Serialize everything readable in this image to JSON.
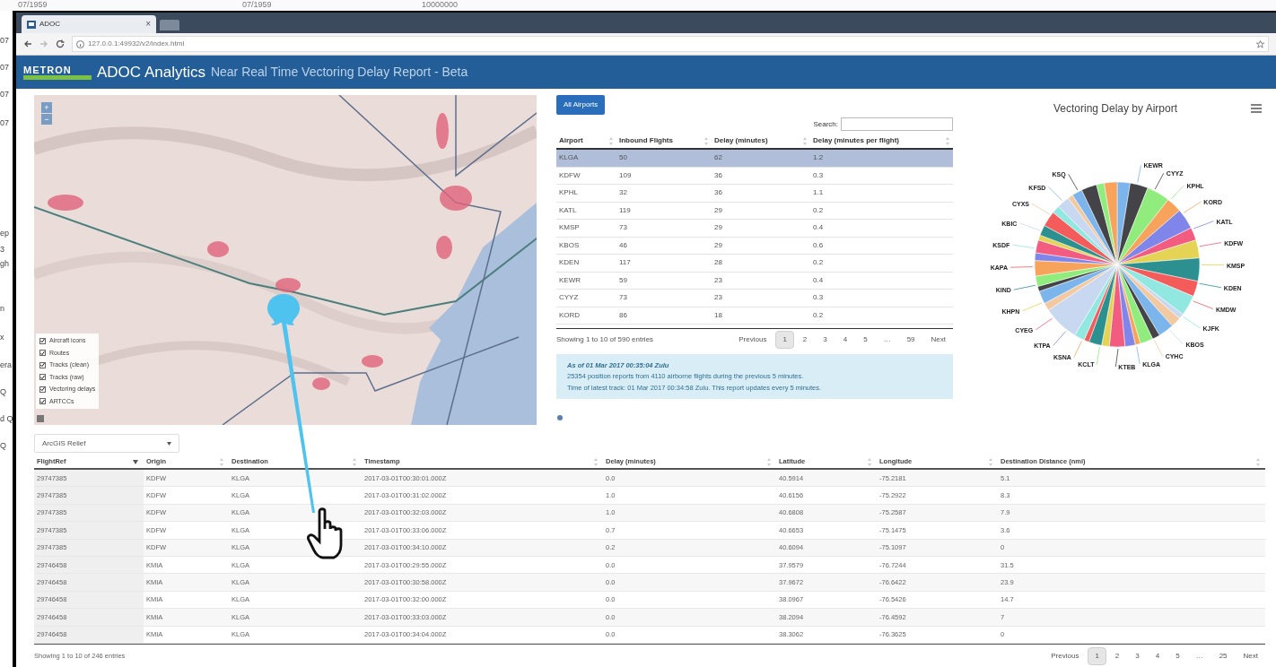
{
  "background_window": {
    "top_fragments": [
      "07/1959",
      "07/1959",
      "10000000"
    ],
    "side_fragments": [
      "07",
      "07",
      "07",
      "07",
      "ep",
      "3",
      "gh",
      "n",
      "x",
      "era",
      "Q",
      "d Q",
      "Q"
    ]
  },
  "browser": {
    "tab_title": "ADOC",
    "tab_close": "×",
    "url": "127.0.0.1:49932/v2/index.html"
  },
  "header": {
    "logo": "METRON",
    "app_name": "ADOC Analytics",
    "subtitle": "Near Real Time Vectoring Delay Report - Beta"
  },
  "map": {
    "zoom_in": "+",
    "zoom_out": "−",
    "layers": [
      {
        "label": "Aircraft icons",
        "checked": true
      },
      {
        "label": "Routes",
        "checked": true
      },
      {
        "label": "Tracks (clean)",
        "checked": true
      },
      {
        "label": "Tracks (raw)",
        "checked": true
      },
      {
        "label": "Vectoring delays",
        "checked": true
      },
      {
        "label": "ARTCCs",
        "checked": true
      }
    ],
    "basemap": "ArcGIS Relief"
  },
  "airports": {
    "button": "All Airports",
    "search_label": "Search:",
    "columns": [
      {
        "label": "Airport",
        "sorted": false
      },
      {
        "label": "Inbound Flights",
        "sorted": false
      },
      {
        "label": "Delay (minutes)",
        "sorted": false
      },
      {
        "label": "Delay (minutes per flight)",
        "sorted": false
      }
    ],
    "rows": [
      {
        "cells": [
          "KLGA",
          "50",
          "62",
          "1.2"
        ],
        "selected": true
      },
      {
        "cells": [
          "KDFW",
          "109",
          "36",
          "0.3"
        ],
        "selected": false
      },
      {
        "cells": [
          "KPHL",
          "32",
          "36",
          "1.1"
        ],
        "selected": false
      },
      {
        "cells": [
          "KATL",
          "119",
          "29",
          "0.2"
        ],
        "selected": false
      },
      {
        "cells": [
          "KMSP",
          "73",
          "29",
          "0.4"
        ],
        "selected": false
      },
      {
        "cells": [
          "KBOS",
          "46",
          "29",
          "0.6"
        ],
        "selected": false
      },
      {
        "cells": [
          "KDEN",
          "117",
          "28",
          "0.2"
        ],
        "selected": false
      },
      {
        "cells": [
          "KEWR",
          "59",
          "23",
          "0.4"
        ],
        "selected": false
      },
      {
        "cells": [
          "CYYZ",
          "73",
          "23",
          "0.3"
        ],
        "selected": false
      },
      {
        "cells": [
          "KORD",
          "86",
          "18",
          "0.2"
        ],
        "selected": false
      }
    ],
    "info": "Showing 1 to 10 of 590 entries",
    "pages": [
      {
        "label": "Previous",
        "selected": false
      },
      {
        "label": "1",
        "selected": true
      },
      {
        "label": "2",
        "selected": false
      },
      {
        "label": "3",
        "selected": false
      },
      {
        "label": "4",
        "selected": false
      },
      {
        "label": "5",
        "selected": false
      },
      {
        "label": "…",
        "selected": false
      },
      {
        "label": "59",
        "selected": false
      },
      {
        "label": "Next",
        "selected": false
      }
    ],
    "notice": [
      "As of 01 Mar 2017 00:35:04 Zulu",
      "25354 position reports from 4110 airborne flights during the previous 5 minutes.",
      "Time of latest track: 01 Mar 2017 00:34:58 Zulu. This report updates every 5 minutes."
    ]
  },
  "pie": {
    "title": "Vectoring Delay by Airport",
    "labels": [
      "KEWR",
      "CYYZ",
      "KPHL",
      "KORD",
      "KATL",
      "KDFW",
      "KMSP",
      "KDEN",
      "KMDW",
      "KJFK",
      "KBOS",
      "CYHC",
      "KLGA",
      "KTEB",
      "KCLT",
      "KSNA",
      "KTPA",
      "CYEG",
      "KHPN",
      "KIND",
      "KAPA",
      "KSDF",
      "KBIC",
      "CYXS",
      "KFSD",
      "KSQ"
    ]
  },
  "flights": {
    "columns": [
      {
        "label": "FlightRef",
        "sorted": true
      },
      {
        "label": "Origin",
        "sorted": false
      },
      {
        "label": "Destination",
        "sorted": false
      },
      {
        "label": "Timestamp",
        "sorted": false
      },
      {
        "label": "Delay (minutes)",
        "sorted": false
      },
      {
        "label": "Latitude",
        "sorted": false
      },
      {
        "label": "Longitude",
        "sorted": false
      },
      {
        "label": "Destination Distance (nmi)",
        "sorted": false
      }
    ],
    "rows": [
      [
        "29747385",
        "KDFW",
        "KLGA",
        "2017-03-01T00:30:01.000Z",
        "0.0",
        "40.5914",
        "-75.2181",
        "5.1"
      ],
      [
        "29747385",
        "KDFW",
        "KLGA",
        "2017-03-01T00:31:02.000Z",
        "1.0",
        "40.6156",
        "-75.2922",
        "8.3"
      ],
      [
        "29747385",
        "KDFW",
        "KLGA",
        "2017-03-01T00:32:03.000Z",
        "1.0",
        "40.6808",
        "-75.2587",
        "7.9"
      ],
      [
        "29747385",
        "KDFW",
        "KLGA",
        "2017-03-01T00:33:06.000Z",
        "0.7",
        "40.6653",
        "-75.1475",
        "3.6"
      ],
      [
        "29747385",
        "KDFW",
        "KLGA",
        "2017-03-01T00:34:10.000Z",
        "0.2",
        "40.6094",
        "-75.1097",
        "0"
      ],
      [
        "29746458",
        "KMIA",
        "KLGA",
        "2017-03-01T00:29:55.000Z",
        "0.0",
        "37.9579",
        "-76.7244",
        "31.5"
      ],
      [
        "29746458",
        "KMIA",
        "KLGA",
        "2017-03-01T00:30:58.000Z",
        "0.0",
        "37.9672",
        "-76.6422",
        "23.9"
      ],
      [
        "29746458",
        "KMIA",
        "KLGA",
        "2017-03-01T00:32:00.000Z",
        "0.0",
        "38.0967",
        "-76.5426",
        "14.7"
      ],
      [
        "29746458",
        "KMIA",
        "KLGA",
        "2017-03-01T00:33:03.000Z",
        "0.0",
        "38.2094",
        "-76.4592",
        "7"
      ],
      [
        "29746458",
        "KMIA",
        "KLGA",
        "2017-03-01T00:34:04.000Z",
        "0.0",
        "38.3062",
        "-76.3625",
        "0"
      ]
    ],
    "info": "Showing 1 to 10 of 246 entries",
    "pages": [
      {
        "label": "Previous",
        "selected": false
      },
      {
        "label": "1",
        "selected": true
      },
      {
        "label": "2",
        "selected": false
      },
      {
        "label": "3",
        "selected": false
      },
      {
        "label": "4",
        "selected": false
      },
      {
        "label": "5",
        "selected": false
      },
      {
        "label": "…",
        "selected": false
      },
      {
        "label": "25",
        "selected": false
      },
      {
        "label": "Next",
        "selected": false
      }
    ]
  }
}
